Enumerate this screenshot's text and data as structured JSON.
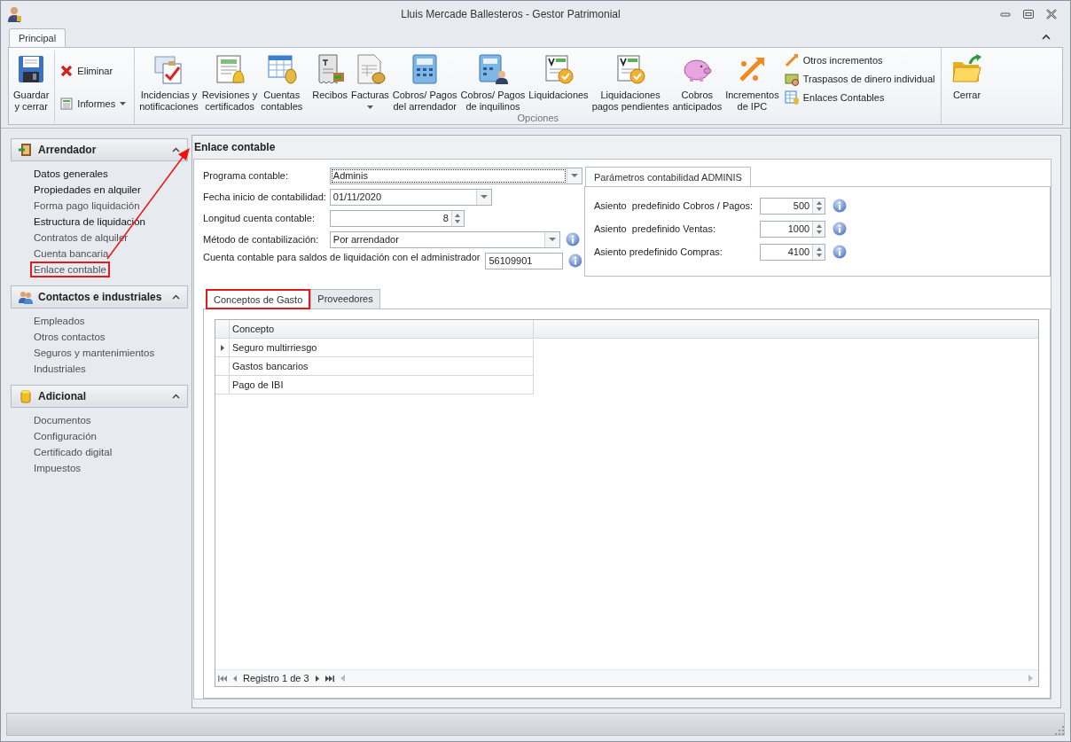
{
  "window": {
    "title": "Lluis Mercade Ballesteros - Gestor Patrimonial"
  },
  "ribbon": {
    "tabs": [
      {
        "label": "Principal",
        "selected": true
      }
    ],
    "save_button": {
      "label": "Guardar\ny cerrar"
    },
    "small_buttons": [
      {
        "label": "Eliminar",
        "dropdown": false
      },
      {
        "label": "Informes",
        "dropdown": true
      }
    ],
    "options_group": {
      "label": "Opciones",
      "buttons": [
        {
          "label": "Incidencias y\nnotificaciones",
          "dropdown": false
        },
        {
          "label": "Revisiones y\ncertificados",
          "dropdown": false
        },
        {
          "label": "Cuentas\ncontables",
          "dropdown": false
        },
        {
          "label": "Recibos",
          "dropdown": false
        },
        {
          "label": "Facturas",
          "dropdown": true
        },
        {
          "label": "Cobros/ Pagos\ndel arrendador",
          "dropdown": false
        },
        {
          "label": "Cobros/ Pagos\nde inquilinos",
          "dropdown": false
        },
        {
          "label": "Liquidaciones",
          "dropdown": false
        },
        {
          "label": "Liquidaciones\npagos pendientes",
          "dropdown": false
        },
        {
          "label": "Cobros\nanticipados",
          "dropdown": false
        },
        {
          "label": "Incrementos\nde IPC",
          "dropdown": false
        }
      ],
      "small_buttons": [
        {
          "label": "Otros incrementos"
        },
        {
          "label": "Traspasos de dinero individual"
        },
        {
          "label": "Enlaces Contables"
        }
      ]
    },
    "close_button": {
      "label": "Cerrar"
    }
  },
  "sidebar": {
    "groups": [
      {
        "title": "Arrendador",
        "expanded": true,
        "items": [
          {
            "label": "Datos generales",
            "emphasized": true,
            "selected": false
          },
          {
            "label": "Propiedades en alquiler",
            "emphasized": true,
            "selected": false
          },
          {
            "label": "Forma pago liquidación",
            "emphasized": false,
            "selected": false
          },
          {
            "label": "Estructura de liquidación",
            "emphasized": true,
            "selected": false
          },
          {
            "label": "Contratos de alquiler",
            "emphasized": false,
            "selected": false
          },
          {
            "label": "Cuenta bancaria",
            "emphasized": false,
            "selected": false
          },
          {
            "label": "Enlace contable",
            "emphasized": false,
            "selected": true
          }
        ]
      },
      {
        "title": "Contactos e industriales",
        "expanded": true,
        "items": [
          {
            "label": "Empleados",
            "emphasized": false,
            "selected": false
          },
          {
            "label": "Otros contactos",
            "emphasized": false,
            "selected": false
          },
          {
            "label": "Seguros y mantenimientos",
            "emphasized": false,
            "selected": false
          },
          {
            "label": "Industriales",
            "emphasized": false,
            "selected": false
          }
        ]
      },
      {
        "title": "Adicional",
        "expanded": true,
        "items": [
          {
            "label": "Documentos",
            "emphasized": false,
            "selected": false
          },
          {
            "label": "Configuración",
            "emphasized": false,
            "selected": false
          },
          {
            "label": "Certificado digital",
            "emphasized": false,
            "selected": false
          },
          {
            "label": "Impuestos",
            "emphasized": false,
            "selected": false
          }
        ]
      }
    ]
  },
  "panel": {
    "title": "Enlace contable",
    "fields": [
      {
        "label": "Programa contable:",
        "kind": "combo",
        "value": "Adminis",
        "info": false
      },
      {
        "label": "Fecha inicio de contabilidad:",
        "kind": "combo",
        "value": "01/11/2020",
        "info": false
      },
      {
        "label": "Longitud cuenta contable:",
        "kind": "spin",
        "value": "8",
        "info": false
      },
      {
        "label": "Método de contabilización:",
        "kind": "combo",
        "value": "Por arrendador",
        "info": true
      },
      {
        "label": "Cuenta contable para saldos de liquidación con el administrador",
        "kind": "text",
        "value": "56109901",
        "info": true
      }
    ],
    "params": {
      "tab": "Parámetros contabilidad ADMINIS",
      "fields": [
        {
          "label": "Asiento  predefinido Cobros / Pagos:",
          "value": "500",
          "info": true
        },
        {
          "label": "Asiento  predefinido Ventas:",
          "value": "1000",
          "info": true
        },
        {
          "label": "Asiento predefinido Compras:",
          "value": "4100",
          "info": true
        }
      ]
    },
    "tabs": [
      {
        "label": "Conceptos de Gasto",
        "selected": true
      },
      {
        "label": "Proveedores",
        "selected": false
      }
    ],
    "grid": {
      "columns": [
        "Concepto"
      ],
      "rows": [
        {
          "concepto": "Seguro multirriesgo",
          "selected": true
        },
        {
          "concepto": "Gastos bancarios",
          "selected": false
        },
        {
          "concepto": "Pago de IBI",
          "selected": false
        }
      ],
      "navigator": "Registro 1 de 3"
    }
  }
}
